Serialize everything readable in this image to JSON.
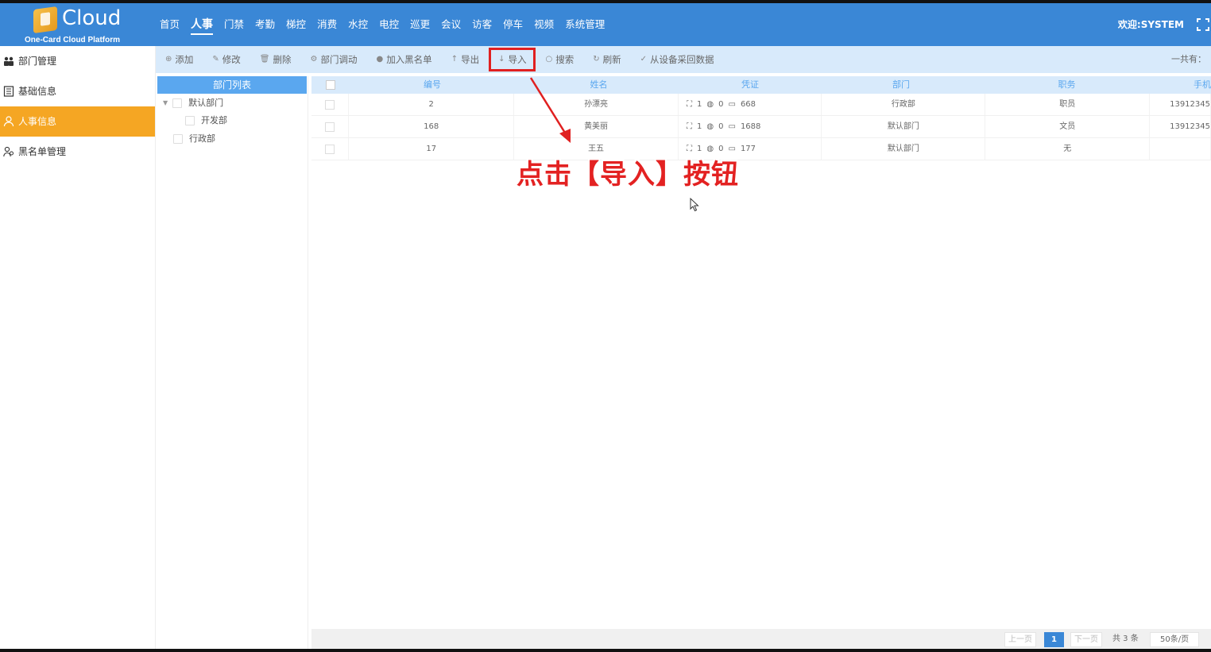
{
  "header": {
    "logo_text": "Cloud",
    "logo_sub": "One-Card Cloud Platform",
    "nav": [
      "首页",
      "人事",
      "门禁",
      "考勤",
      "梯控",
      "消费",
      "水控",
      "电控",
      "巡更",
      "会议",
      "访客",
      "停车",
      "视频",
      "系统管理"
    ],
    "active_nav": "人事",
    "welcome": "欢迎:SYSTEM"
  },
  "sidebar": {
    "items": [
      {
        "label": "部门管理",
        "icon": "people-icon"
      },
      {
        "label": "基础信息",
        "icon": "list-icon"
      },
      {
        "label": "人事信息",
        "icon": "user-icon"
      },
      {
        "label": "黑名单管理",
        "icon": "users-icon"
      }
    ],
    "active": "人事信息"
  },
  "toolbar": {
    "add": "添加",
    "edit": "修改",
    "delete": "删除",
    "transfer": "部门调动",
    "blacklist": "加入黑名单",
    "export": "导出",
    "import": "导入",
    "search": "搜索",
    "refresh": "刷新",
    "collect": "从设备采回数据",
    "total": "一共有："
  },
  "tree": {
    "title": "部门列表",
    "nodes": [
      "默认部门",
      "开发部",
      "行政部"
    ]
  },
  "table": {
    "headers": [
      "编号",
      "姓名",
      "凭证",
      "部门",
      "职务",
      "手机"
    ],
    "rows": [
      {
        "id": "2",
        "name": "孙漂亮",
        "face": "1",
        "finger": "0",
        "card": "668",
        "dept": "行政部",
        "title": "职员",
        "phone": "13912345"
      },
      {
        "id": "168",
        "name": "黄美丽",
        "face": "1",
        "finger": "0",
        "card": "1688",
        "dept": "默认部门",
        "title": "文员",
        "phone": "13912345"
      },
      {
        "id": "17",
        "name": "王五",
        "face": "1",
        "finger": "0",
        "card": "177",
        "dept": "默认部门",
        "title": "无",
        "phone": ""
      }
    ]
  },
  "pager": {
    "prev": "上一页",
    "current": "1",
    "next": "下一页",
    "total": "共 3 条",
    "size": "50条/页"
  },
  "annotation": "点击【导入】按钮",
  "colors": {
    "header": "#3a87d6",
    "active": "#f5a623",
    "highlight": "#e02020"
  }
}
